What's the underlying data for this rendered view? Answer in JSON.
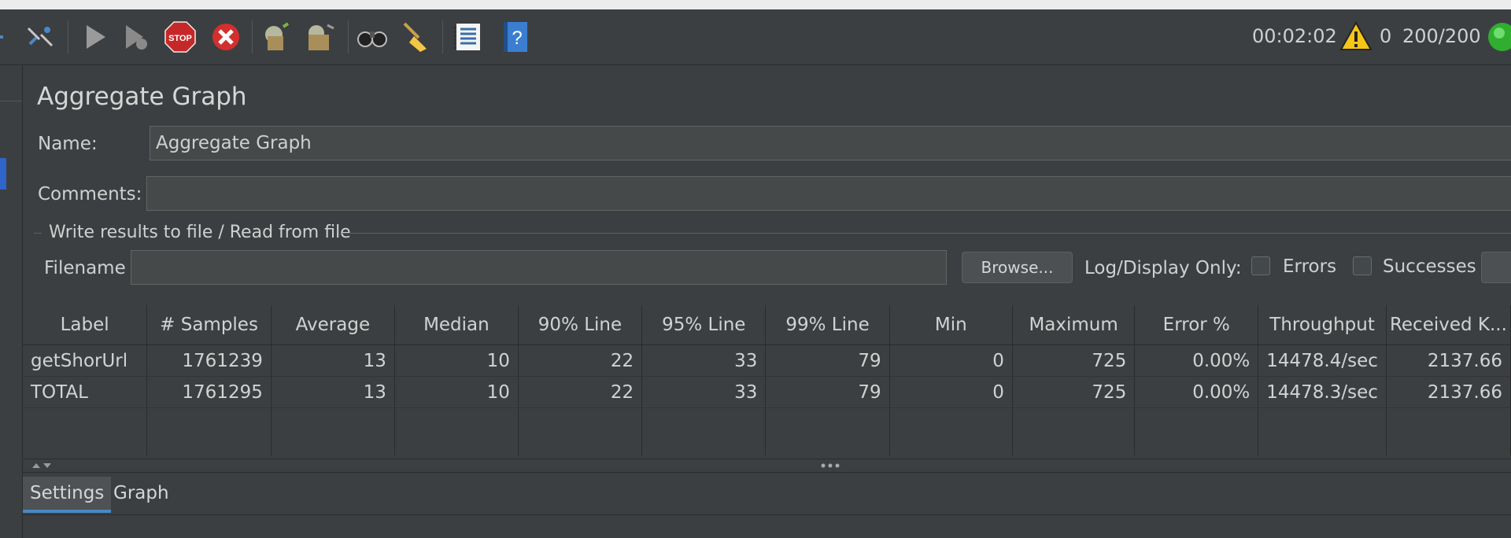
{
  "toolbar": {
    "icons": [
      "collapse-icon",
      "toggle-icon",
      "start-icon",
      "start-no-pause-icon",
      "stop-icon",
      "shutdown-icon",
      "clear-icon",
      "clear-all-icon",
      "search-icon",
      "reset-search-icon",
      "function-helper-icon",
      "help-icon"
    ],
    "elapsed_time": "00:02:02",
    "warning_count": "0",
    "threads": "200/200"
  },
  "panel": {
    "title": "Aggregate Graph",
    "name_label": "Name:",
    "name_value": "Aggregate Graph",
    "comments_label": "Comments:",
    "comments_value": "",
    "file_section_title": "Write results to file / Read from file",
    "filename_label": "Filename",
    "filename_value": "",
    "browse_label": "Browse...",
    "log_display_label": "Log/Display Only:",
    "errors_label": "Errors",
    "successes_label": "Successes"
  },
  "table": {
    "columns": [
      "Label",
      "# Samples",
      "Average",
      "Median",
      "90% Line",
      "95% Line",
      "99% Line",
      "Min",
      "Maximum",
      "Error %",
      "Throughput",
      "Received K..."
    ],
    "rows": [
      [
        "getShorUrl",
        "1761239",
        "13",
        "10",
        "22",
        "33",
        "79",
        "0",
        "725",
        "0.00%",
        "14478.4/sec",
        "2137.66"
      ],
      [
        "TOTAL",
        "1761295",
        "13",
        "10",
        "22",
        "33",
        "79",
        "0",
        "725",
        "0.00%",
        "14478.3/sec",
        "2137.66"
      ]
    ]
  },
  "tabs": [
    "Settings",
    "Graph"
  ],
  "colors": {
    "background": "#3c3f41",
    "field": "#45494a",
    "accent": "#4a88c7",
    "stop": "#c62828"
  }
}
